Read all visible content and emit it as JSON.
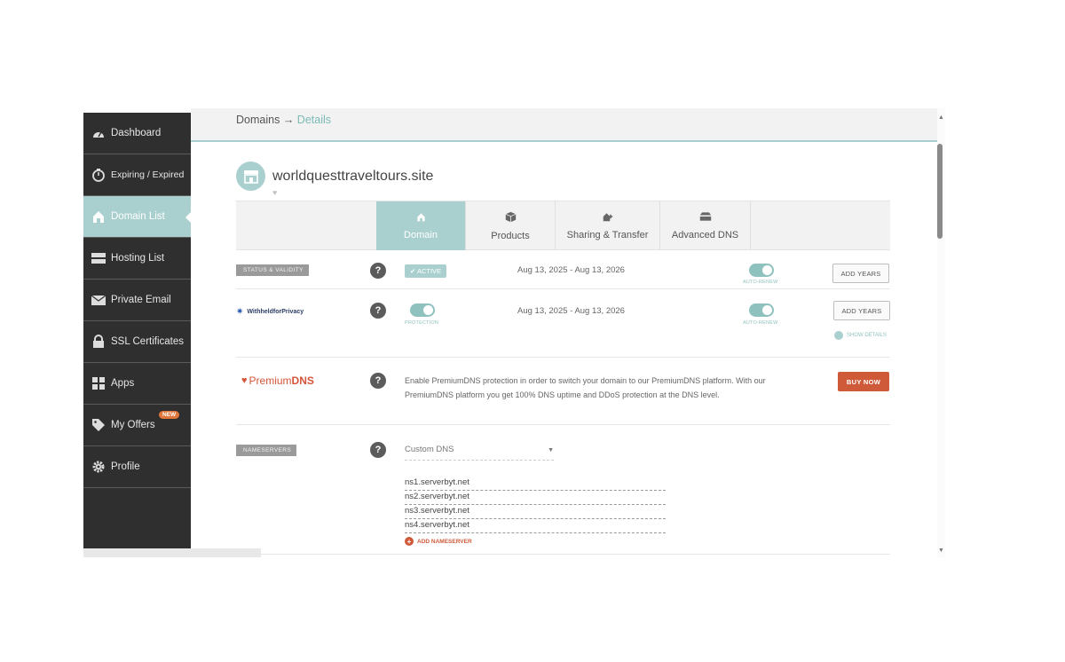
{
  "sidebar": {
    "items": [
      {
        "label": "Dashboard",
        "icon": "speedometer-icon"
      },
      {
        "label": "Expiring / Expired",
        "icon": "timer-icon"
      },
      {
        "label": "Domain List",
        "icon": "home-icon",
        "active": true
      },
      {
        "label": "Hosting List",
        "icon": "server-icon"
      },
      {
        "label": "Private Email",
        "icon": "envelope-icon"
      },
      {
        "label": "SSL Certificates",
        "icon": "lock-icon"
      },
      {
        "label": "Apps",
        "icon": "apps-icon"
      },
      {
        "label": "My Offers",
        "icon": "tag-icon",
        "badge": "NEW"
      },
      {
        "label": "Profile",
        "icon": "gear-icon"
      }
    ]
  },
  "breadcrumb": {
    "root": "Domains",
    "arrow": "→",
    "current": "Details"
  },
  "domain": {
    "name": "worldquesttraveltours.site"
  },
  "tabs": [
    {
      "label": "Domain",
      "icon": "home-icon",
      "active": true
    },
    {
      "label": "Products",
      "icon": "box-icon"
    },
    {
      "label": "Sharing & Transfer",
      "icon": "share-icon"
    },
    {
      "label": "Advanced DNS",
      "icon": "stack-icon"
    }
  ],
  "status_row": {
    "tag": "STATUS & VALIDITY",
    "badge": "ACTIVE",
    "dates": "Aug 13, 2025 - Aug 13, 2026",
    "toggle_caption": "AUTO-RENEW",
    "button": "ADD YEARS"
  },
  "privacy_row": {
    "logo_text": "WithheldforPrivacy",
    "toggle_caption": "PROTECTION",
    "dates": "Aug 13, 2025 - Aug 13, 2026",
    "auto_caption": "AUTO-RENEW",
    "button": "ADD YEARS",
    "show_details": "SHOW DETAILS"
  },
  "premium_row": {
    "logo_prefix": "Premium",
    "logo_suffix": "DNS",
    "text": "Enable PremiumDNS protection in order to switch your domain to our PremiumDNS platform. With our PremiumDNS platform you get 100% DNS uptime and DDoS protection at the DNS level.",
    "button": "BUY NOW"
  },
  "nameservers_row": {
    "tag": "NAMESERVERS",
    "select_value": "Custom DNS",
    "servers": [
      "ns1.serverbyt.net",
      "ns2.serverbyt.net",
      "ns3.serverbyt.net",
      "ns4.serverbyt.net"
    ],
    "add_label": "ADD NAMESERVER"
  },
  "help_symbol": "?",
  "colors": {
    "accent": "#a9d0ce",
    "sidebar": "#2f2f2f",
    "buy": "#cf5a3a"
  }
}
